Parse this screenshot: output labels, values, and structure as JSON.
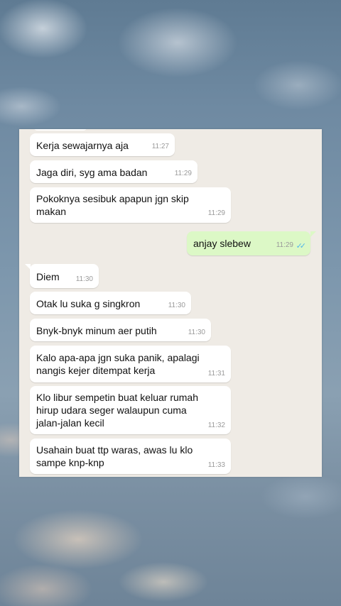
{
  "messages": [
    {
      "text": "Kerja sewajarnya aja",
      "time": "11:27",
      "dir": "in"
    },
    {
      "text": "Jaga diri, syg ama badan",
      "time": "11:29",
      "dir": "in"
    },
    {
      "text": "Pokoknya sesibuk apapun jgn skip\nmakan",
      "time": "11:29",
      "dir": "in"
    },
    {
      "text": "anjay slebew",
      "time": "11:29",
      "dir": "out",
      "status": "read"
    },
    {
      "text": "Diem",
      "time": "11:30",
      "dir": "in"
    },
    {
      "text": "Otak lu suka g singkron",
      "time": "11:30",
      "dir": "in"
    },
    {
      "text": "Bnyk-bnyk minum aer putih",
      "time": "11:30",
      "dir": "in"
    },
    {
      "text": "Kalo apa-apa jgn suka panik, apalagi\nnangis kejer ditempat kerja",
      "time": "11:31",
      "dir": "in"
    },
    {
      "text": "Klo libur sempetin buat keluar rumah\nhirup udara seger walaupun cuma\njalan-jalan kecil",
      "time": "11:32",
      "dir": "in"
    },
    {
      "text": "Usahain buat ttp waras, awas lu klo\nsampe knp-knp",
      "time": "11:33",
      "dir": "in"
    }
  ],
  "read_tick_icon": "double-check-icon",
  "colors": {
    "incoming": "#ffffff",
    "outgoing": "#dcf8c6",
    "chat_bg": "#efebe5",
    "tick": "#4fb6ec"
  }
}
